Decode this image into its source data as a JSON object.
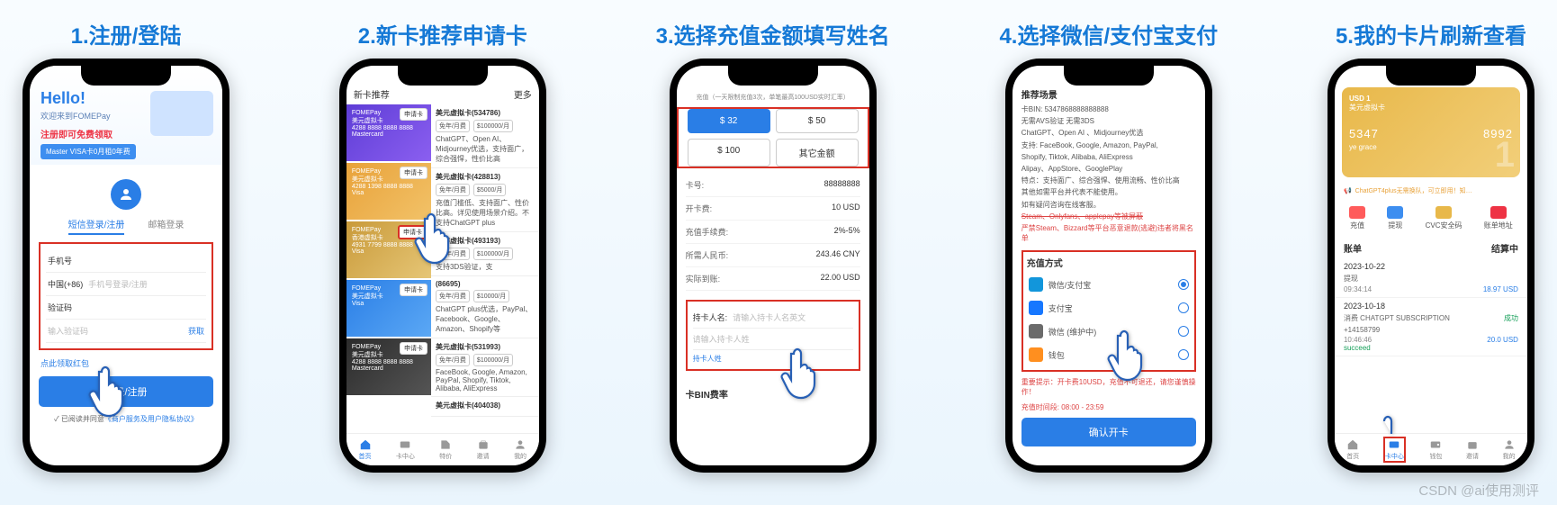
{
  "watermark": "CSDN @ai使用测评",
  "steps": [
    {
      "title": "1.注册/登陆"
    },
    {
      "title": "2.新卡推荐申请卡"
    },
    {
      "title": "3.选择充值金额填写姓名"
    },
    {
      "title": "4.选择微信/支付宝支付"
    },
    {
      "title": "5.我的卡片刷新查看"
    }
  ],
  "s1": {
    "hello": "Hello!",
    "welcome": "欢迎来到FOMEPay",
    "register_free": "注册即可免费领取",
    "badge": "Master VISA卡0月租0年费",
    "tab_sms": "短信登录/注册",
    "tab_email": "邮箱登录",
    "phone_label": "手机号",
    "country": "中国(+86)",
    "phone_ph": "手机号登录/注册",
    "code_label": "验证码",
    "code_ph": "输入验证码",
    "get_code": "获取",
    "link_left": "点此领取红包",
    "link_right": "",
    "login_btn": "登录/注册",
    "agree_prefix": "✓ 已阅读并同意",
    "agree_link": "《商户服务及用户隐私协议》"
  },
  "s2": {
    "header_left": "新卡推荐",
    "header_right": "更多",
    "apply": "申请卡",
    "cards": [
      {
        "brand": "FOMEPay",
        "type": "美元虚拟卡",
        "num": "4288 8888 8888 8888",
        "sub": "Mastercard"
      },
      {
        "brand": "FOMEPay",
        "type": "美元虚拟卡",
        "num": "4288 1398 8888 8888",
        "sub": "Visa"
      },
      {
        "brand": "FOMEPay",
        "type": "香港虚拟卡",
        "num": "4931 7799 8888 8888",
        "sub": "Visa"
      },
      {
        "brand": "FOMEPay",
        "type": "美元虚拟卡",
        "num": "",
        "sub": "Visa"
      },
      {
        "brand": "FOMEPay",
        "type": "美元虚拟卡",
        "num": "4288 8888 8888 8888",
        "sub": "Mastercard"
      }
    ],
    "descs": [
      {
        "title": "美元虚拟卡(534786)",
        "fee": [
          "免年/月费",
          "$100000/月"
        ],
        "body": "ChatGPT、Open AI、Midjourney优选，支持面广，综合强悍，性价比高"
      },
      {
        "title": "美元虚拟卡(428813)",
        "fee": [
          "免年/月费",
          "$5000/月"
        ],
        "body": "充值门槛低、支持面广、性价比高。详见使用场景介绍。不支持ChatGPT plus"
      },
      {
        "title": "香港虚拟卡(493193)",
        "fee": [
          "免年/月费",
          "$100000/月"
        ],
        "body": "支持3DS验证，支"
      },
      {
        "title": "(86695)",
        "fee": [
          "免年/月费",
          "$10000/月"
        ],
        "body": "ChatGPT plus优选，PayPal、Facebook、Google、Amazon、Shopify等"
      },
      {
        "title": "美元虚拟卡(531993)",
        "fee": [
          "免年/月费",
          "$100000/月"
        ],
        "body": "FaceBook, Google, Amazon, PayPal, Shopify, Tiktok, Alibaba, AliExpress"
      },
      {
        "title": "美元虚拟卡(404038)",
        "fee": [],
        "body": ""
      }
    ],
    "nav": [
      "首页",
      "卡中心",
      "特价",
      "邀请",
      "我的"
    ]
  },
  "s3": {
    "tip_prefix": "充值",
    "tip": "（一天限制充值3次，单笔最高100USD实时汇率）",
    "amts": [
      "$ 32",
      "$ 50",
      "$ 100",
      "其它金额"
    ],
    "rows": [
      {
        "k": "卡号:",
        "v": "88888888"
      },
      {
        "k": "开卡费:",
        "v": "10 USD"
      },
      {
        "k": "充值手续费:",
        "v": "2%-5%"
      },
      {
        "k": "所需人民币:",
        "v": "243.46 CNY"
      },
      {
        "k": "实际到账:",
        "v": "22.00 USD"
      }
    ],
    "name_label": "持卡人名:",
    "name_ph": "请输入持卡人名英文",
    "surname_ph": "请输入持卡人姓",
    "name_link": "持卡人姓",
    "section": "卡BIN费率"
  },
  "s4": {
    "scene_title": "推荐场景",
    "lines": [
      "卡BIN: 5347868888888888",
      "无需AVS验证 无需3DS",
      "ChatGPT、Open AI 、Midjourney优选",
      "支持: FaceBook, Google, Amazon, PayPal,",
      "Shopify, Tiktok, Alibaba, AliExpress",
      "Alipay、AppStore、GooglePlay",
      "特点：支持面广、综合强悍、使用流畅、性价比高",
      "其他如需平台并代表不能使用。",
      "如有疑问咨询在线客服。"
    ],
    "strike": "Steam、Onlyfans、applepay等被屏蔽",
    "redline": "严禁Steam、Bizzard等平台恶意退款(逃避)违者将黑名单",
    "pay_title": "充值方式",
    "opts": [
      {
        "icon": "#1296db",
        "label": "微信/支付宝",
        "on": true
      },
      {
        "icon": "#1677ff",
        "label": "支付宝",
        "on": false
      },
      {
        "icon": "#6b6b6b",
        "label": "微信 (维护中)",
        "on": false
      },
      {
        "icon": "#ff8f1f",
        "label": "钱包",
        "on": false
      }
    ],
    "warn": "重要提示：开卡费10USD，充值不可退还，请您谨慎操作！",
    "time": "充值时间段: 08:00 - 23:59",
    "confirm": "确认开卡"
  },
  "s5": {
    "usd": "USD 1",
    "cardtype": "美元虚拟卡",
    "num_left": "5347",
    "num_right": "8992",
    "name": "ye grace",
    "notice": "ChatGPT4plus无需换队，可立即用！知…",
    "stats": [
      "充值",
      "提现",
      "CVC安全码",
      "账单地址"
    ],
    "bill_title": "账单",
    "bill_right": "结算中",
    "tx": [
      {
        "date": "2023-10-22",
        "sub": "提现",
        "time": "09:34:14",
        "amt": "18.97 USD"
      },
      {
        "date": "2023-10-18",
        "sub": "消费 CHATGPT SUBSCRIPTION",
        "phone": "+14158799",
        "time": "10:46:46",
        "amt": "20.0 USD",
        "status": "成功",
        "succeed": "succeed"
      }
    ],
    "nav": [
      "首页",
      "卡中心",
      "钱包",
      "邀请",
      "我的"
    ]
  }
}
